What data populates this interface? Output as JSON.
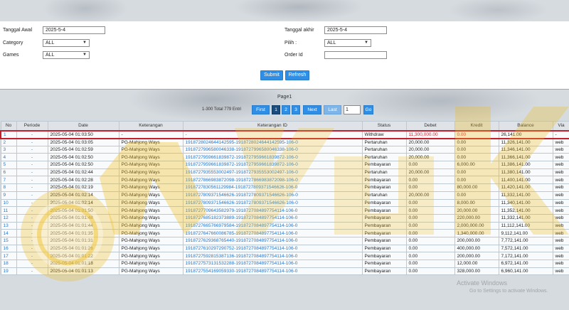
{
  "filters": {
    "tanggal_awal_label": "Tanggal Awal",
    "tanggal_awal_value": "2025-5-4",
    "tanggal_akhir_label": "Tanggal akhir",
    "tanggal_akhir_value": "2025-5-4",
    "category_label": "Category",
    "category_value": "ALL",
    "pilih_label": "Pilih :",
    "pilih_value": "ALL",
    "games_label": "Games",
    "games_value": "ALL",
    "order_id_label": "Order Id",
    "order_id_value": ""
  },
  "actions": {
    "submit_label": "Submit",
    "refresh_label": "Refresh"
  },
  "pager": {
    "page_title": "Page1",
    "total_text": "1-300 Total 779 Entri",
    "first_label": "First",
    "pages": [
      "1",
      "2",
      "3"
    ],
    "active_page": "1",
    "next_label": "Next",
    "last_label": "Last",
    "page_input": "1",
    "go_label": "Go"
  },
  "table": {
    "headers": [
      "No",
      "Periode",
      "Date",
      "Keterangan",
      "Keterangan ID",
      "Status",
      "Debet",
      "Kredit",
      "Balance",
      "Via"
    ],
    "rows": [
      [
        "1",
        "-",
        "2025-05-04 01:03:50",
        "-",
        "-",
        "Withdraw",
        "11,300,000.00",
        "0.00",
        "26,141.00",
        "-"
      ],
      [
        "2",
        "-",
        "2025-05-04 01:03:05",
        "PG-Mahjong Ways",
        "1918728024644142595-1918728024644142595-106-0",
        "Pertaruhan",
        "20,000.00",
        "0.00",
        "11,326,141.00",
        "web"
      ],
      [
        "3",
        "-",
        "2025-05-04 01:02:59",
        "PG-Mahjong Ways",
        "1918727996580046338-1918727996580046338-106-0",
        "Pertaruhan",
        "20,000.00",
        "0.00",
        "11,346,141.00",
        "web"
      ],
      [
        "4",
        "-",
        "2025-05-04 01:02:50",
        "PG-Mahjong Ways",
        "1918727959661839872-1918727959661839872-106-0",
        "Pertaruhan",
        "20,000.00",
        "0.00",
        "11,366,141.00",
        "web"
      ],
      [
        "5",
        "-",
        "2025-05-04 01:02:50",
        "PG-Mahjong Ways",
        "1918727959661839872-1918727959661839872-106-0",
        "Pembayaran",
        "0.00",
        "6,000.00",
        "11,386,141.00",
        "web"
      ],
      [
        "6",
        "-",
        "2025-05-04 01:02:44",
        "PG-Mahjong Ways",
        "1918727935553002497-1918727935553002497-106-0",
        "Pertaruhan",
        "20,000.00",
        "0.00",
        "11,380,141.00",
        "web"
      ],
      [
        "7",
        "-",
        "2025-05-04 01:02:28",
        "PG-Mahjong Ways",
        "1918727866983872098-1918727866983872098-106-0",
        "Pembayaran",
        "0.00",
        "0.00",
        "11,400,141.00",
        "web"
      ],
      [
        "8",
        "-",
        "2025-05-04 01:02:19",
        "PG-Mahjong Ways",
        "1918727830561129984-1918727809371546626-106-0",
        "Pembayaran",
        "0.00",
        "80,000.00",
        "11,420,141.00",
        "web"
      ],
      [
        "9",
        "-",
        "2025-05-04 01:02:14",
        "PG-Mahjong Ways",
        "1918727809371546626-1918727809371546626-106-0",
        "Pertaruhan",
        "20,000.00",
        "0.00",
        "11,332,141.00",
        "web"
      ],
      [
        "10",
        "-",
        "2025-05-04 01:02:14",
        "PG-Mahjong Ways",
        "1918727809371546626-1918727809371546626-106-0",
        "Pembayaran",
        "0.00",
        "8,000.00",
        "11,340,141.00",
        "web"
      ],
      [
        "11",
        "-",
        "2025-05-04 01:01:50",
        "PG-Mahjong Ways",
        "1918727709643582979-1918727084897754114-106-0",
        "Pembayaran",
        "0.00",
        "20,000.00",
        "11,352,141.00",
        "web"
      ],
      [
        "12",
        "-",
        "2025-05-04 01:01:48",
        "PG-Mahjong Ways",
        "1918727685182373889-1918727084897754114-106-0",
        "Pembayaran",
        "0.00",
        "220,000.00",
        "11,332,141.00",
        "web"
      ],
      [
        "13",
        "-",
        "2025-05-04 01:01:44",
        "PG-Mahjong Ways",
        "1918727665766979584-1918727084897754114-106-0",
        "Pembayaran",
        "0.00",
        "2,000,000.00",
        "11,112,141.00",
        "web"
      ],
      [
        "14",
        "-",
        "2025-05-04 01:01:35",
        "PG-Mahjong Ways",
        "1918727647660086785-1918727084897754114-106-0",
        "Pembayaran",
        "0.00",
        "1,340,000.00",
        "9,112,141.00",
        "web"
      ],
      [
        "15",
        "-",
        "2025-05-04 01:01:31",
        "PG-Mahjong Ways",
        "1918727629368765440-1918727084897754114-106-0",
        "Pembayaran",
        "0.00",
        "200,000.00",
        "7,772,141.00",
        "web"
      ],
      [
        "16",
        "-",
        "2025-05-04 01:01:26",
        "PG-Mahjong Ways",
        "1918727610297290752-1918727084897754114-106-0",
        "Pembayaran",
        "0.00",
        "400,000.00",
        "7,572,141.00",
        "web"
      ],
      [
        "17",
        "-",
        "2025-05-04 01:01:22",
        "PG-Mahjong Ways",
        "1918727592815387136-1918727084897754114-106-0",
        "Pembayaran",
        "0.00",
        "200,000.00",
        "7,172,141.00",
        "web"
      ],
      [
        "18",
        "-",
        "2025-05-04 01:01:18",
        "PG-Mahjong Ways",
        "1918727573131532288-1918727084897754114-106-0",
        "Pembayaran",
        "0.00",
        "12,000.00",
        "6,972,141.00",
        "web"
      ],
      [
        "19",
        "-",
        "2025-05-04 01:01:13",
        "PG-Mahjong Ways",
        "1918727554169059330-1918727084897754114-106-0",
        "Pembayaran",
        "0.00",
        "328,000.00",
        "6,960,141.00",
        "web"
      ]
    ]
  },
  "overlay": {
    "watermark_text": "WYUK",
    "windows_activate_title": "Activate Windows",
    "windows_activate_sub": "Go to Settings to activate Windows."
  },
  "colors": {
    "accent": "#2f8fe6",
    "link": "#2a77c9",
    "highlight_border": "#c41e2b",
    "debit_red": "#d4232e",
    "watermark": "#f0be1e"
  }
}
